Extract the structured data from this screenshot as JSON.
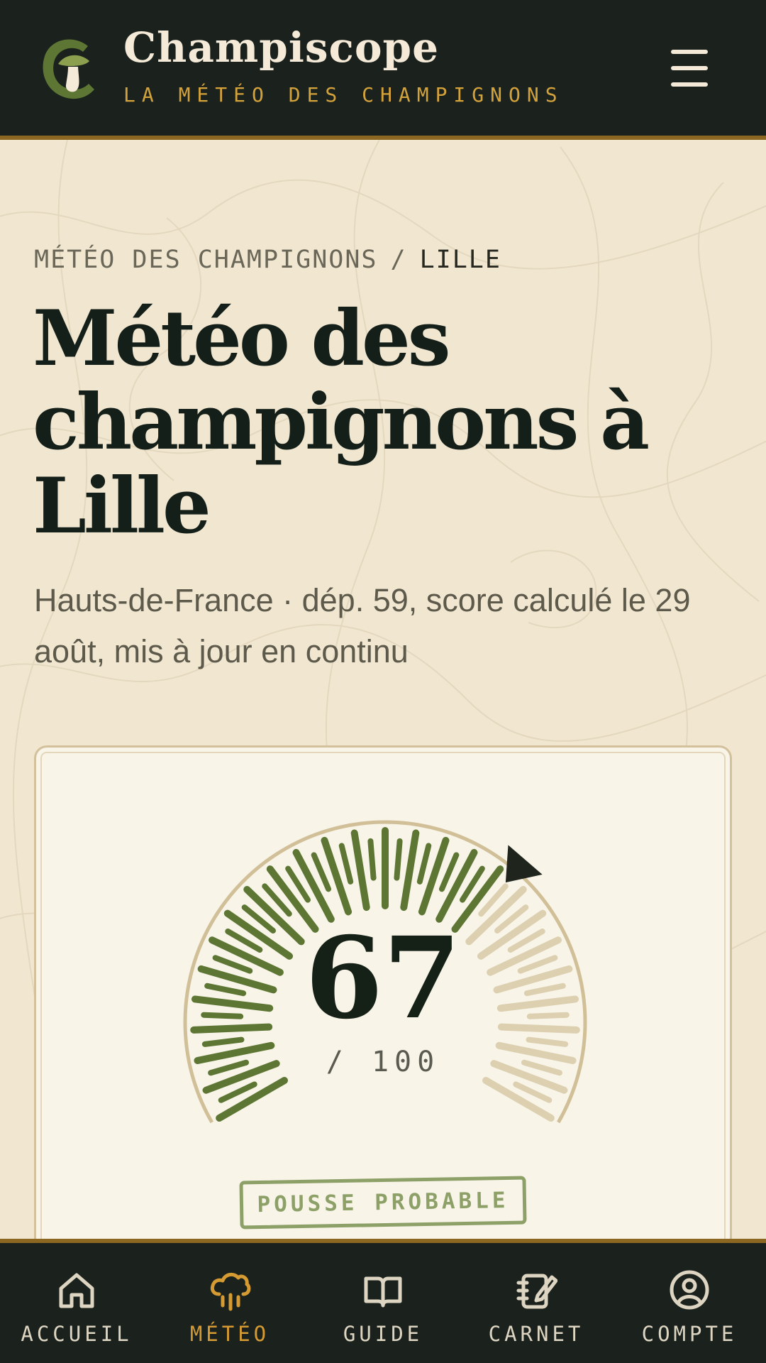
{
  "header": {
    "brand_name": "Champiscope",
    "tagline": "LA MÉTÉO DES CHAMPIGNONS",
    "logo_icon": "mushroom-c-logo-icon",
    "menu_icon": "hamburger-menu-icon"
  },
  "breadcrumb": {
    "section": "MÉTÉO DES CHAMPIGNONS",
    "separator": "/",
    "current": "LILLE"
  },
  "page": {
    "title": "Météo des champignons à Lille",
    "subtitle": "Hauts-de-France · dép. 59, score calculé le 29 août, mis à jour en continu"
  },
  "score": {
    "value": "67",
    "max": "/ 100",
    "percent": 67,
    "status": "POUSSE PROBABLE",
    "colors": {
      "filled": "#5d7633",
      "empty": "#ddd0b1",
      "pointer": "#1f241c"
    }
  },
  "bottom_nav": {
    "items": [
      {
        "label": "ACCUEIL",
        "icon": "home-icon",
        "active": false
      },
      {
        "label": "MÉTÉO",
        "icon": "rain-cloud-icon",
        "active": true
      },
      {
        "label": "GUIDE",
        "icon": "open-book-icon",
        "active": false
      },
      {
        "label": "CARNET",
        "icon": "notebook-pen-icon",
        "active": false
      },
      {
        "label": "COMPTE",
        "icon": "account-icon",
        "active": false
      }
    ]
  },
  "colors": {
    "header_bg": "#1b221d",
    "accent_gold": "#d4a23b",
    "page_bg": "#f1e7d1",
    "active_nav": "#d59b32"
  }
}
